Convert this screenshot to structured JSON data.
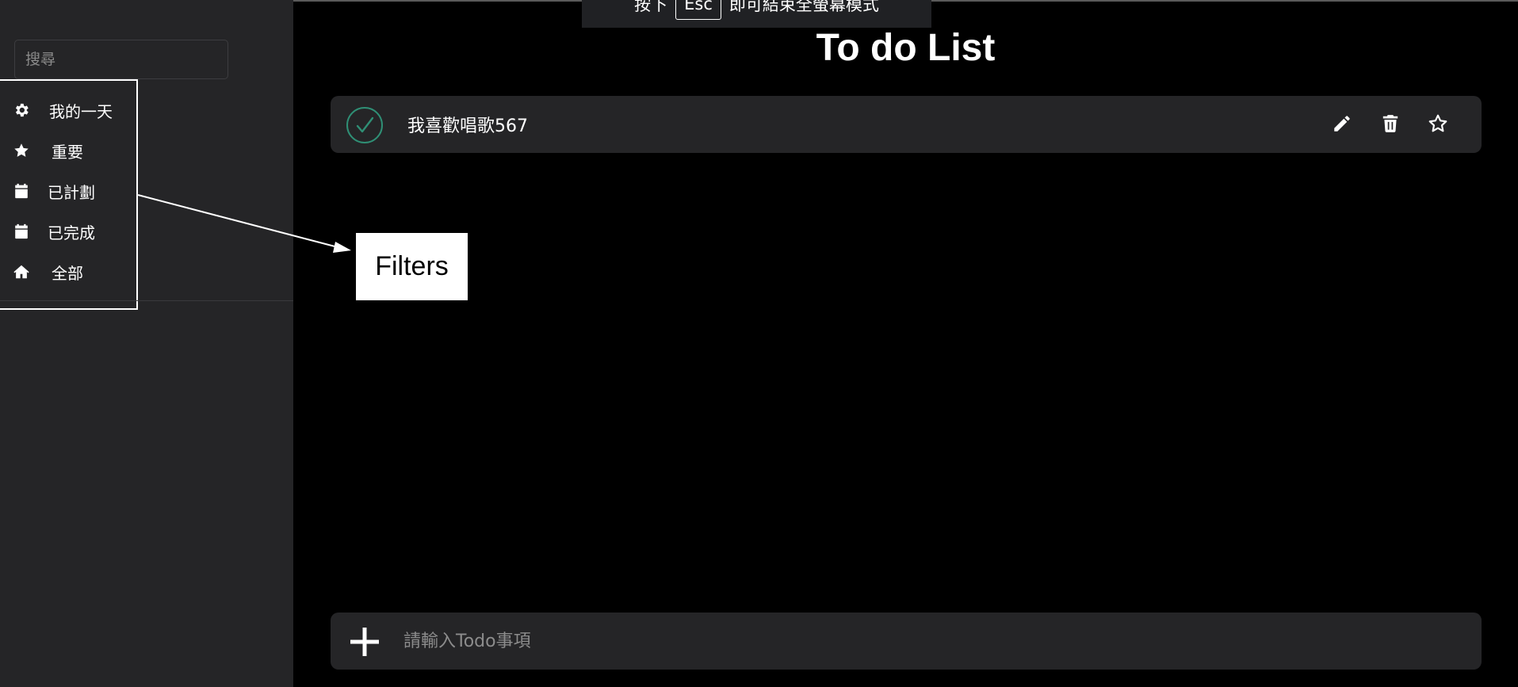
{
  "fullscreen_notice": {
    "prefix": "按下",
    "key": "Esc",
    "suffix": "即可結束全螢幕模式"
  },
  "sidebar": {
    "search_placeholder": "搜尋",
    "filters": [
      {
        "label": "我的一天",
        "icon": "gear-icon"
      },
      {
        "label": "重要",
        "icon": "star-icon"
      },
      {
        "label": "已計劃",
        "icon": "calendar-icon"
      },
      {
        "label": "已完成",
        "icon": "calendar-icon"
      },
      {
        "label": "全部",
        "icon": "home-icon"
      }
    ]
  },
  "main": {
    "title": "To do List",
    "todos": [
      {
        "text": "我喜歡唱歌567",
        "completed": true
      }
    ],
    "add_placeholder": "請輸入Todo事項"
  },
  "annotation": {
    "label": "Filters"
  },
  "colors": {
    "background": "#000000",
    "panel": "#252527",
    "check": "#2f8f75"
  }
}
